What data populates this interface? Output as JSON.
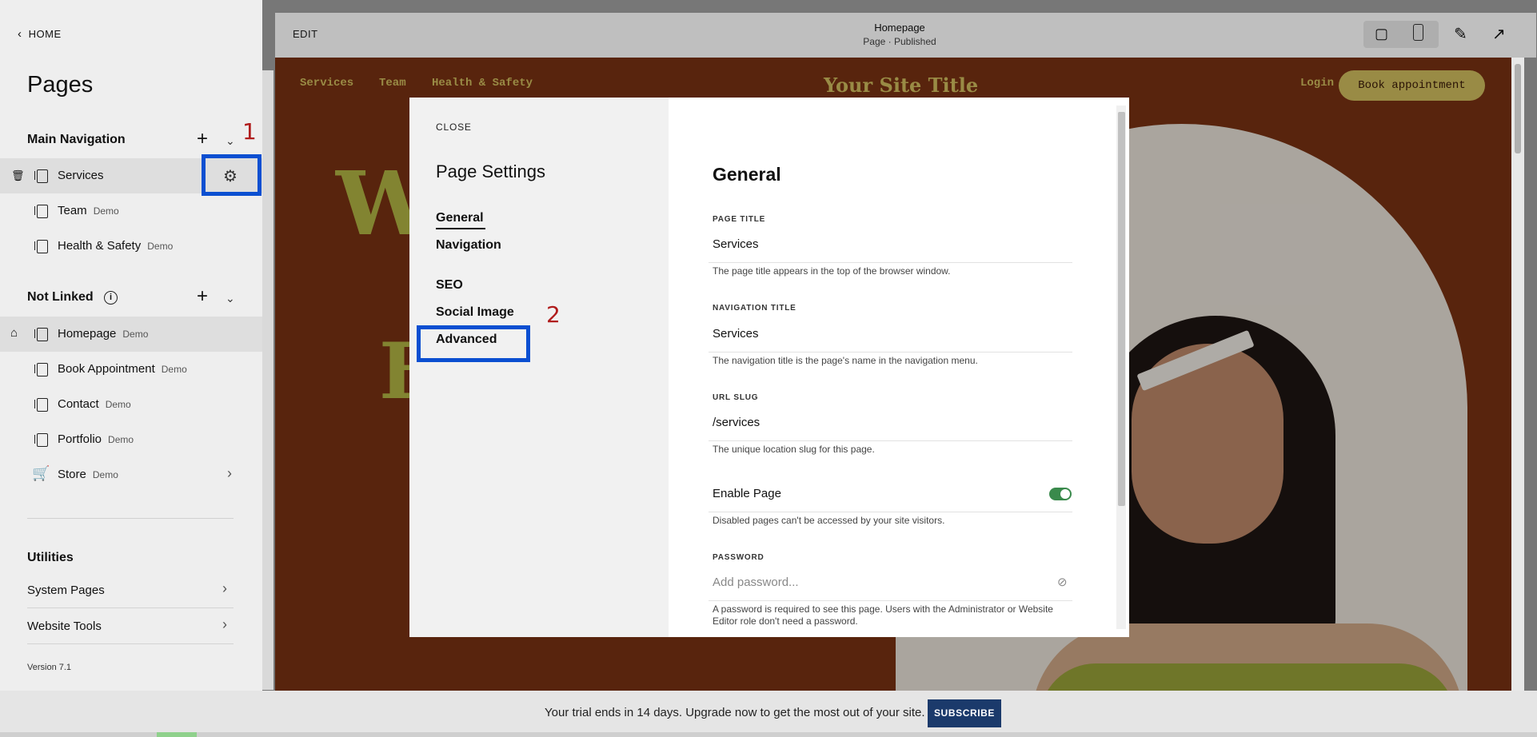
{
  "sidebar": {
    "home_label": "HOME",
    "title": "Pages",
    "main_nav": {
      "title": "Main Navigation",
      "items": [
        {
          "label": "Services",
          "badge": ""
        },
        {
          "label": "Team",
          "badge": "Demo"
        },
        {
          "label": "Health & Safety",
          "badge": "Demo"
        }
      ]
    },
    "not_linked": {
      "title": "Not Linked",
      "items": [
        {
          "label": "Homepage",
          "badge": "Demo"
        },
        {
          "label": "Book Appointment",
          "badge": "Demo"
        },
        {
          "label": "Contact",
          "badge": "Demo"
        },
        {
          "label": "Portfolio",
          "badge": "Demo"
        },
        {
          "label": "Store",
          "badge": "Demo"
        }
      ]
    },
    "utilities": {
      "title": "Utilities",
      "items": [
        {
          "label": "System Pages"
        },
        {
          "label": "Website Tools"
        }
      ]
    },
    "version": "Version 7.1"
  },
  "topbar": {
    "edit_label": "EDIT",
    "page_title": "Homepage",
    "page_status": "Page · Published"
  },
  "site": {
    "nav": [
      "Services",
      "Team",
      "Health & Safety"
    ],
    "title": "Your Site Title",
    "login": "Login",
    "book_button": "Book appointment",
    "hero_letters": [
      "W",
      "E"
    ]
  },
  "annotations": {
    "one": "1",
    "two": "2"
  },
  "modal": {
    "close_label": "CLOSE",
    "title": "Page Settings",
    "menu": [
      "General",
      "Navigation",
      "SEO",
      "Social Image",
      "Advanced"
    ],
    "section_title": "General",
    "page_title": {
      "label": "PAGE TITLE",
      "value": "Services",
      "help": "The page title appears in the top of the browser window."
    },
    "nav_title": {
      "label": "NAVIGATION TITLE",
      "value": "Services",
      "help": "The navigation title is the page's name in the navigation menu."
    },
    "url_slug": {
      "label": "URL SLUG",
      "value": "/services",
      "help": "The unique location slug for this page."
    },
    "enable_page": {
      "label": "Enable Page",
      "enabled": true,
      "help": "Disabled pages can't be accessed by your site visitors."
    },
    "password": {
      "label": "PASSWORD",
      "placeholder": "Add password...",
      "help": "A password is required to see this page. Users with the Administrator or Website Editor role don't need a password."
    }
  },
  "trial": {
    "text": "Your trial ends in 14 days. Upgrade now to get the most out of your site.",
    "subscribe": "SUBSCRIBE"
  },
  "colors": {
    "accent_annotation": "#0b4fd1",
    "annotation_number": "#b01c1c",
    "site_background": "#7a3212",
    "site_accent": "#d4c160",
    "toggle_on": "#3a8a4c",
    "subscribe_bg": "#1b3a6b"
  }
}
